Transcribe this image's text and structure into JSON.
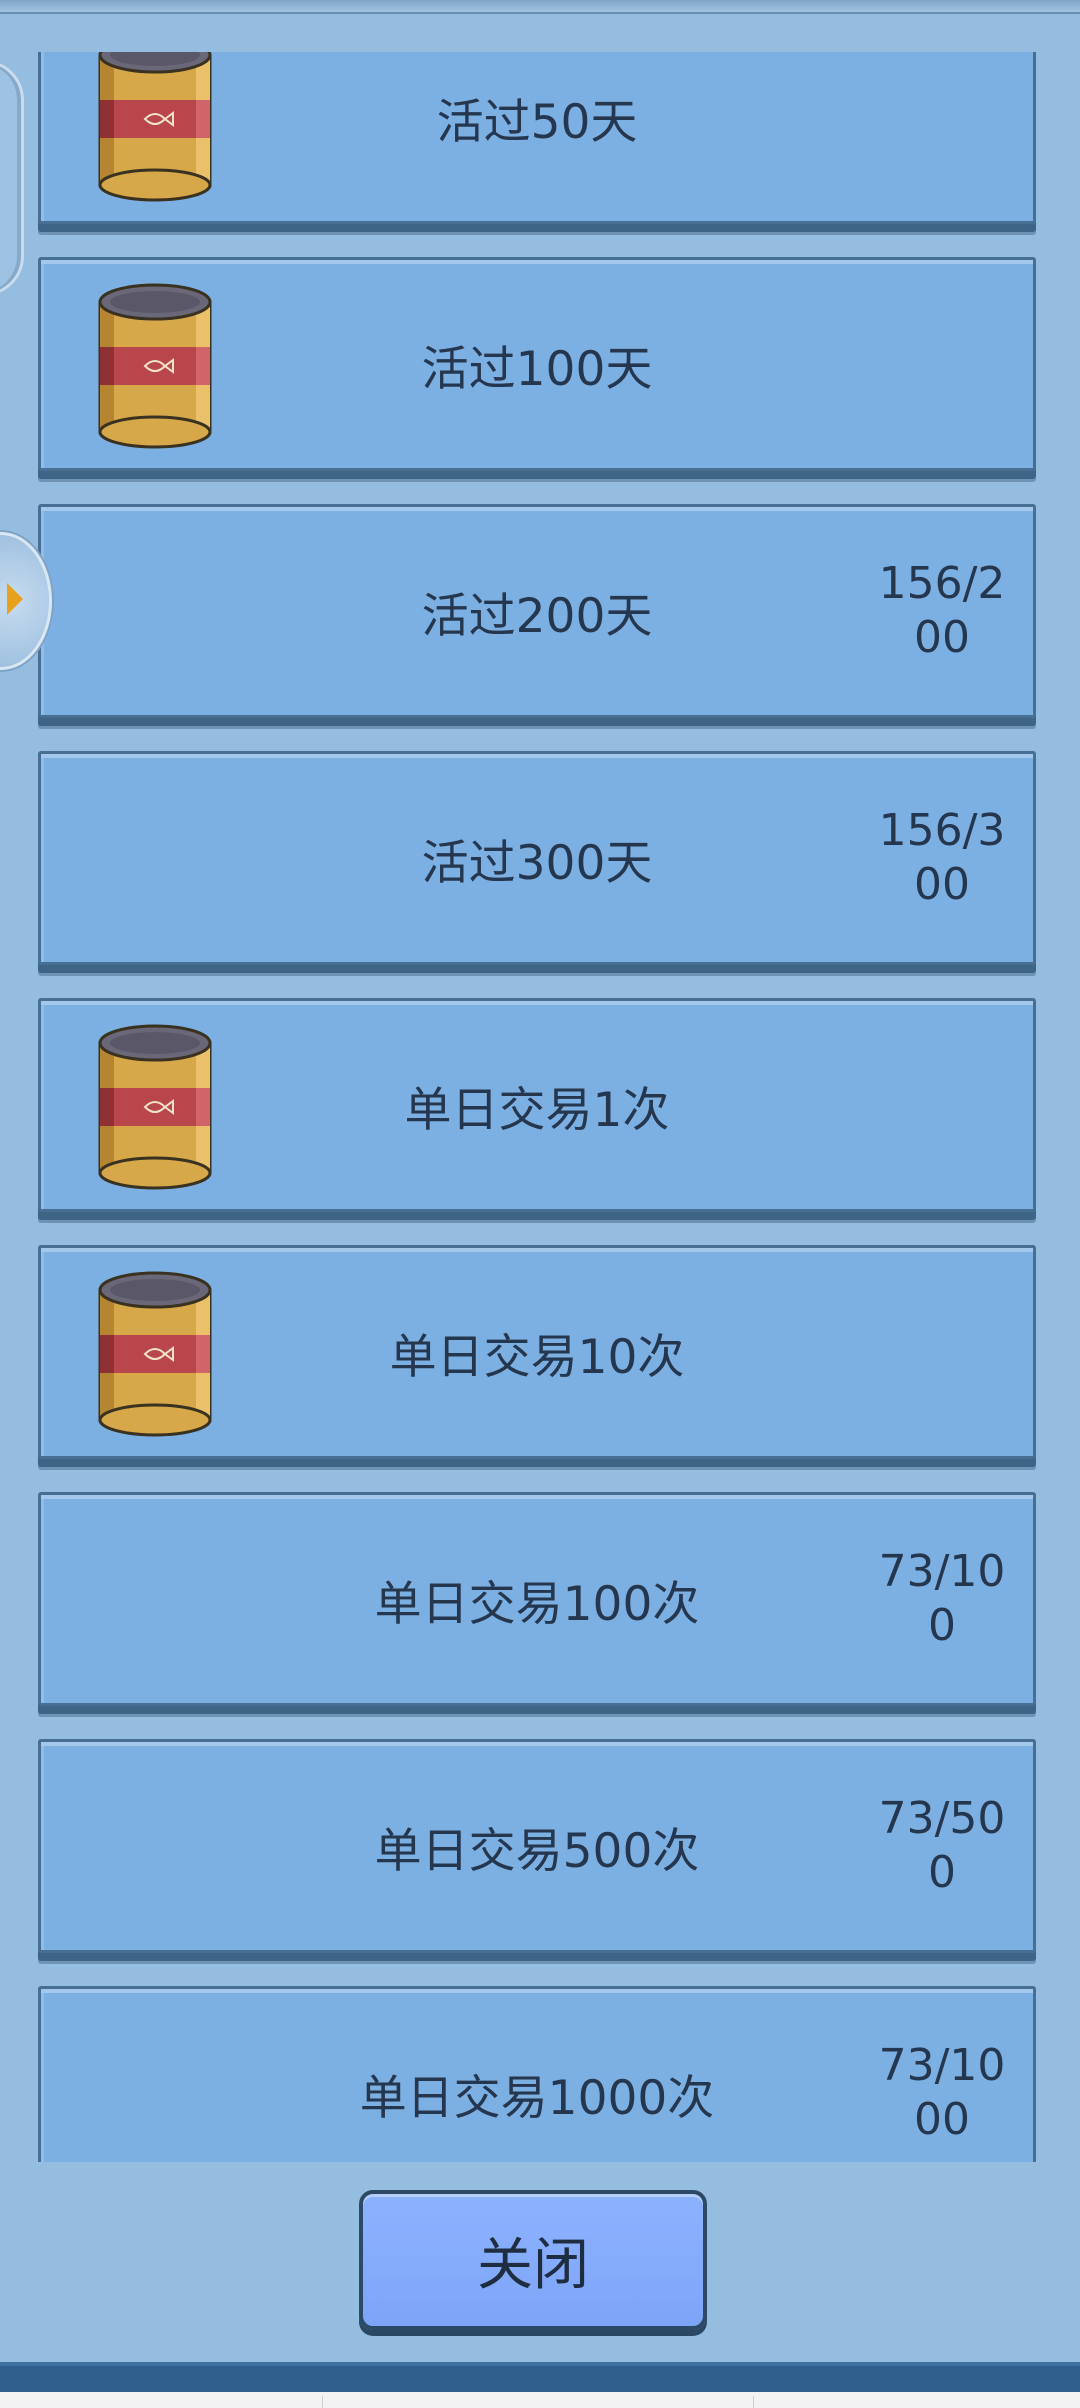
{
  "achievements": [
    {
      "title": "活过50天",
      "progress": "",
      "has_reward_icon": true
    },
    {
      "title": "活过100天",
      "progress": "",
      "has_reward_icon": true
    },
    {
      "title": "活过200天",
      "progress": "156/200",
      "has_reward_icon": false
    },
    {
      "title": "活过300天",
      "progress": "156/300",
      "has_reward_icon": false
    },
    {
      "title": "单日交易1次",
      "progress": "",
      "has_reward_icon": true
    },
    {
      "title": "单日交易10次",
      "progress": "",
      "has_reward_icon": true
    },
    {
      "title": "单日交易100次",
      "progress": "73/100",
      "has_reward_icon": false
    },
    {
      "title": "单日交易500次",
      "progress": "73/500",
      "has_reward_icon": false
    },
    {
      "title": "单日交易1000次",
      "progress": "73/1000",
      "has_reward_icon": false
    }
  ],
  "reward_icon": "fish-can-icon",
  "side_handle_icon": "chevron-right-icon",
  "close_button": {
    "label": "关闭"
  },
  "colors": {
    "card_fill": "#7db0e2",
    "card_border": "#476f93",
    "panel_background": "#95bde0",
    "button_fill": "#8cb2ff",
    "text": "#25364f"
  }
}
